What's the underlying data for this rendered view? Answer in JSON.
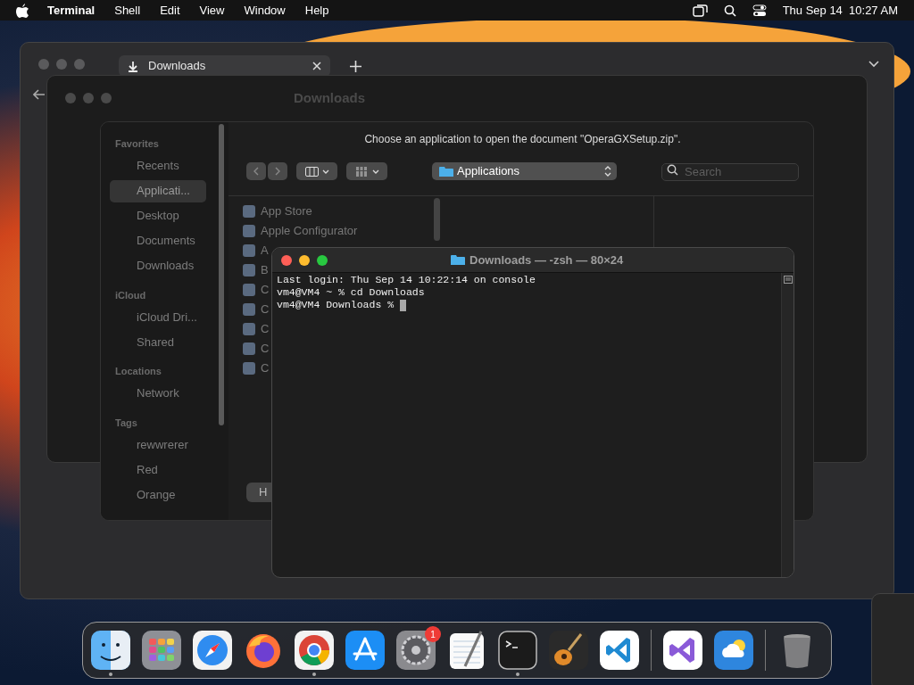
{
  "menu_bar": {
    "app": "Terminal",
    "menus": [
      "Shell",
      "Edit",
      "View",
      "Window",
      "Help"
    ],
    "clock": "Thu Sep 14  10:27 AM"
  },
  "browser": {
    "tab": "Downloads"
  },
  "finder": {
    "title": "Downloads"
  },
  "dialog": {
    "prompt": "Choose an application to open the document \"OperaGXSetup.zip\".",
    "location": "Applications",
    "search_placeholder": "Search",
    "sidebar": [
      {
        "heading": "Favorites",
        "items": [
          {
            "label": "Recents",
            "selected": false
          },
          {
            "label": "Applicati...",
            "selected": true
          },
          {
            "label": "Desktop",
            "selected": false
          },
          {
            "label": "Documents",
            "selected": false
          },
          {
            "label": "Downloads",
            "selected": false
          }
        ]
      },
      {
        "heading": "iCloud",
        "items": [
          {
            "label": "iCloud Dri...",
            "selected": false
          },
          {
            "label": "Shared",
            "selected": false
          }
        ]
      },
      {
        "heading": "Locations",
        "items": [
          {
            "label": "Network",
            "selected": false
          }
        ]
      },
      {
        "heading": "Tags",
        "items": [
          {
            "label": "rewwrerer",
            "selected": false
          },
          {
            "label": "Red",
            "selected": false
          },
          {
            "label": "Orange",
            "selected": false
          }
        ]
      }
    ],
    "apps": [
      "App Store",
      "Apple Configurator",
      "A",
      "B",
      "C",
      "C",
      "C",
      "C",
      "C"
    ],
    "button": "H"
  },
  "terminal": {
    "title": "Downloads — -zsh — 80×24",
    "lines": [
      "Last login: Thu Sep 14 10:22:14 on console",
      "vm4@VM4 ~ % cd Downloads",
      "vm4@VM4 Downloads %"
    ]
  },
  "dock": [
    {
      "kind": "finder",
      "running": true
    },
    {
      "kind": "launchpad",
      "running": false
    },
    {
      "kind": "safari",
      "running": false
    },
    {
      "kind": "firefox",
      "running": false
    },
    {
      "kind": "chrome",
      "running": true
    },
    {
      "kind": "appstore",
      "running": false
    },
    {
      "kind": "settings",
      "running": false,
      "badge": "1"
    },
    {
      "kind": "textedit",
      "running": false
    },
    {
      "kind": "terminal",
      "running": true
    },
    {
      "kind": "garageband",
      "running": false
    },
    {
      "kind": "vscode",
      "running": false
    },
    {
      "kind": "divider"
    },
    {
      "kind": "vs",
      "running": false
    },
    {
      "kind": "weather",
      "running": false
    },
    {
      "kind": "divider"
    },
    {
      "kind": "trash",
      "running": false
    }
  ]
}
